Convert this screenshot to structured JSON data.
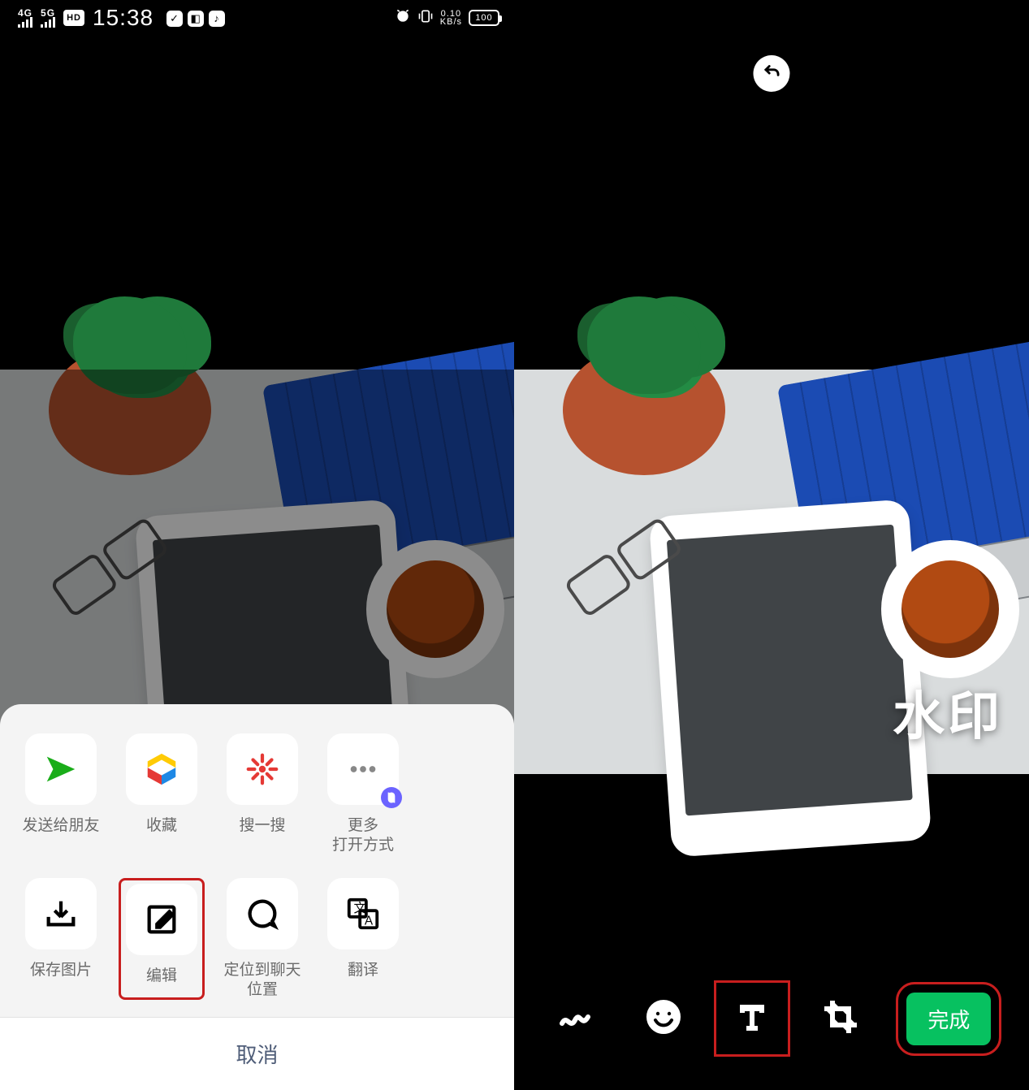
{
  "status": {
    "net1": "4G",
    "net2": "5G",
    "hd": "HD",
    "time": "15:38",
    "kbs_top": "0.10",
    "kbs_bot": "KB/s",
    "battery": "100"
  },
  "left_sheet": {
    "row1": [
      {
        "label": "发送给朋友"
      },
      {
        "label": "收藏"
      },
      {
        "label": "搜一搜"
      },
      {
        "label": "更多\n打开方式"
      }
    ],
    "row2": [
      {
        "label": "保存图片"
      },
      {
        "label": "编辑"
      },
      {
        "label": "定位到聊天\n位置"
      },
      {
        "label": "翻译"
      }
    ],
    "cancel": "取消"
  },
  "right_editor": {
    "watermark_text": "水印",
    "done_label": "完成"
  }
}
